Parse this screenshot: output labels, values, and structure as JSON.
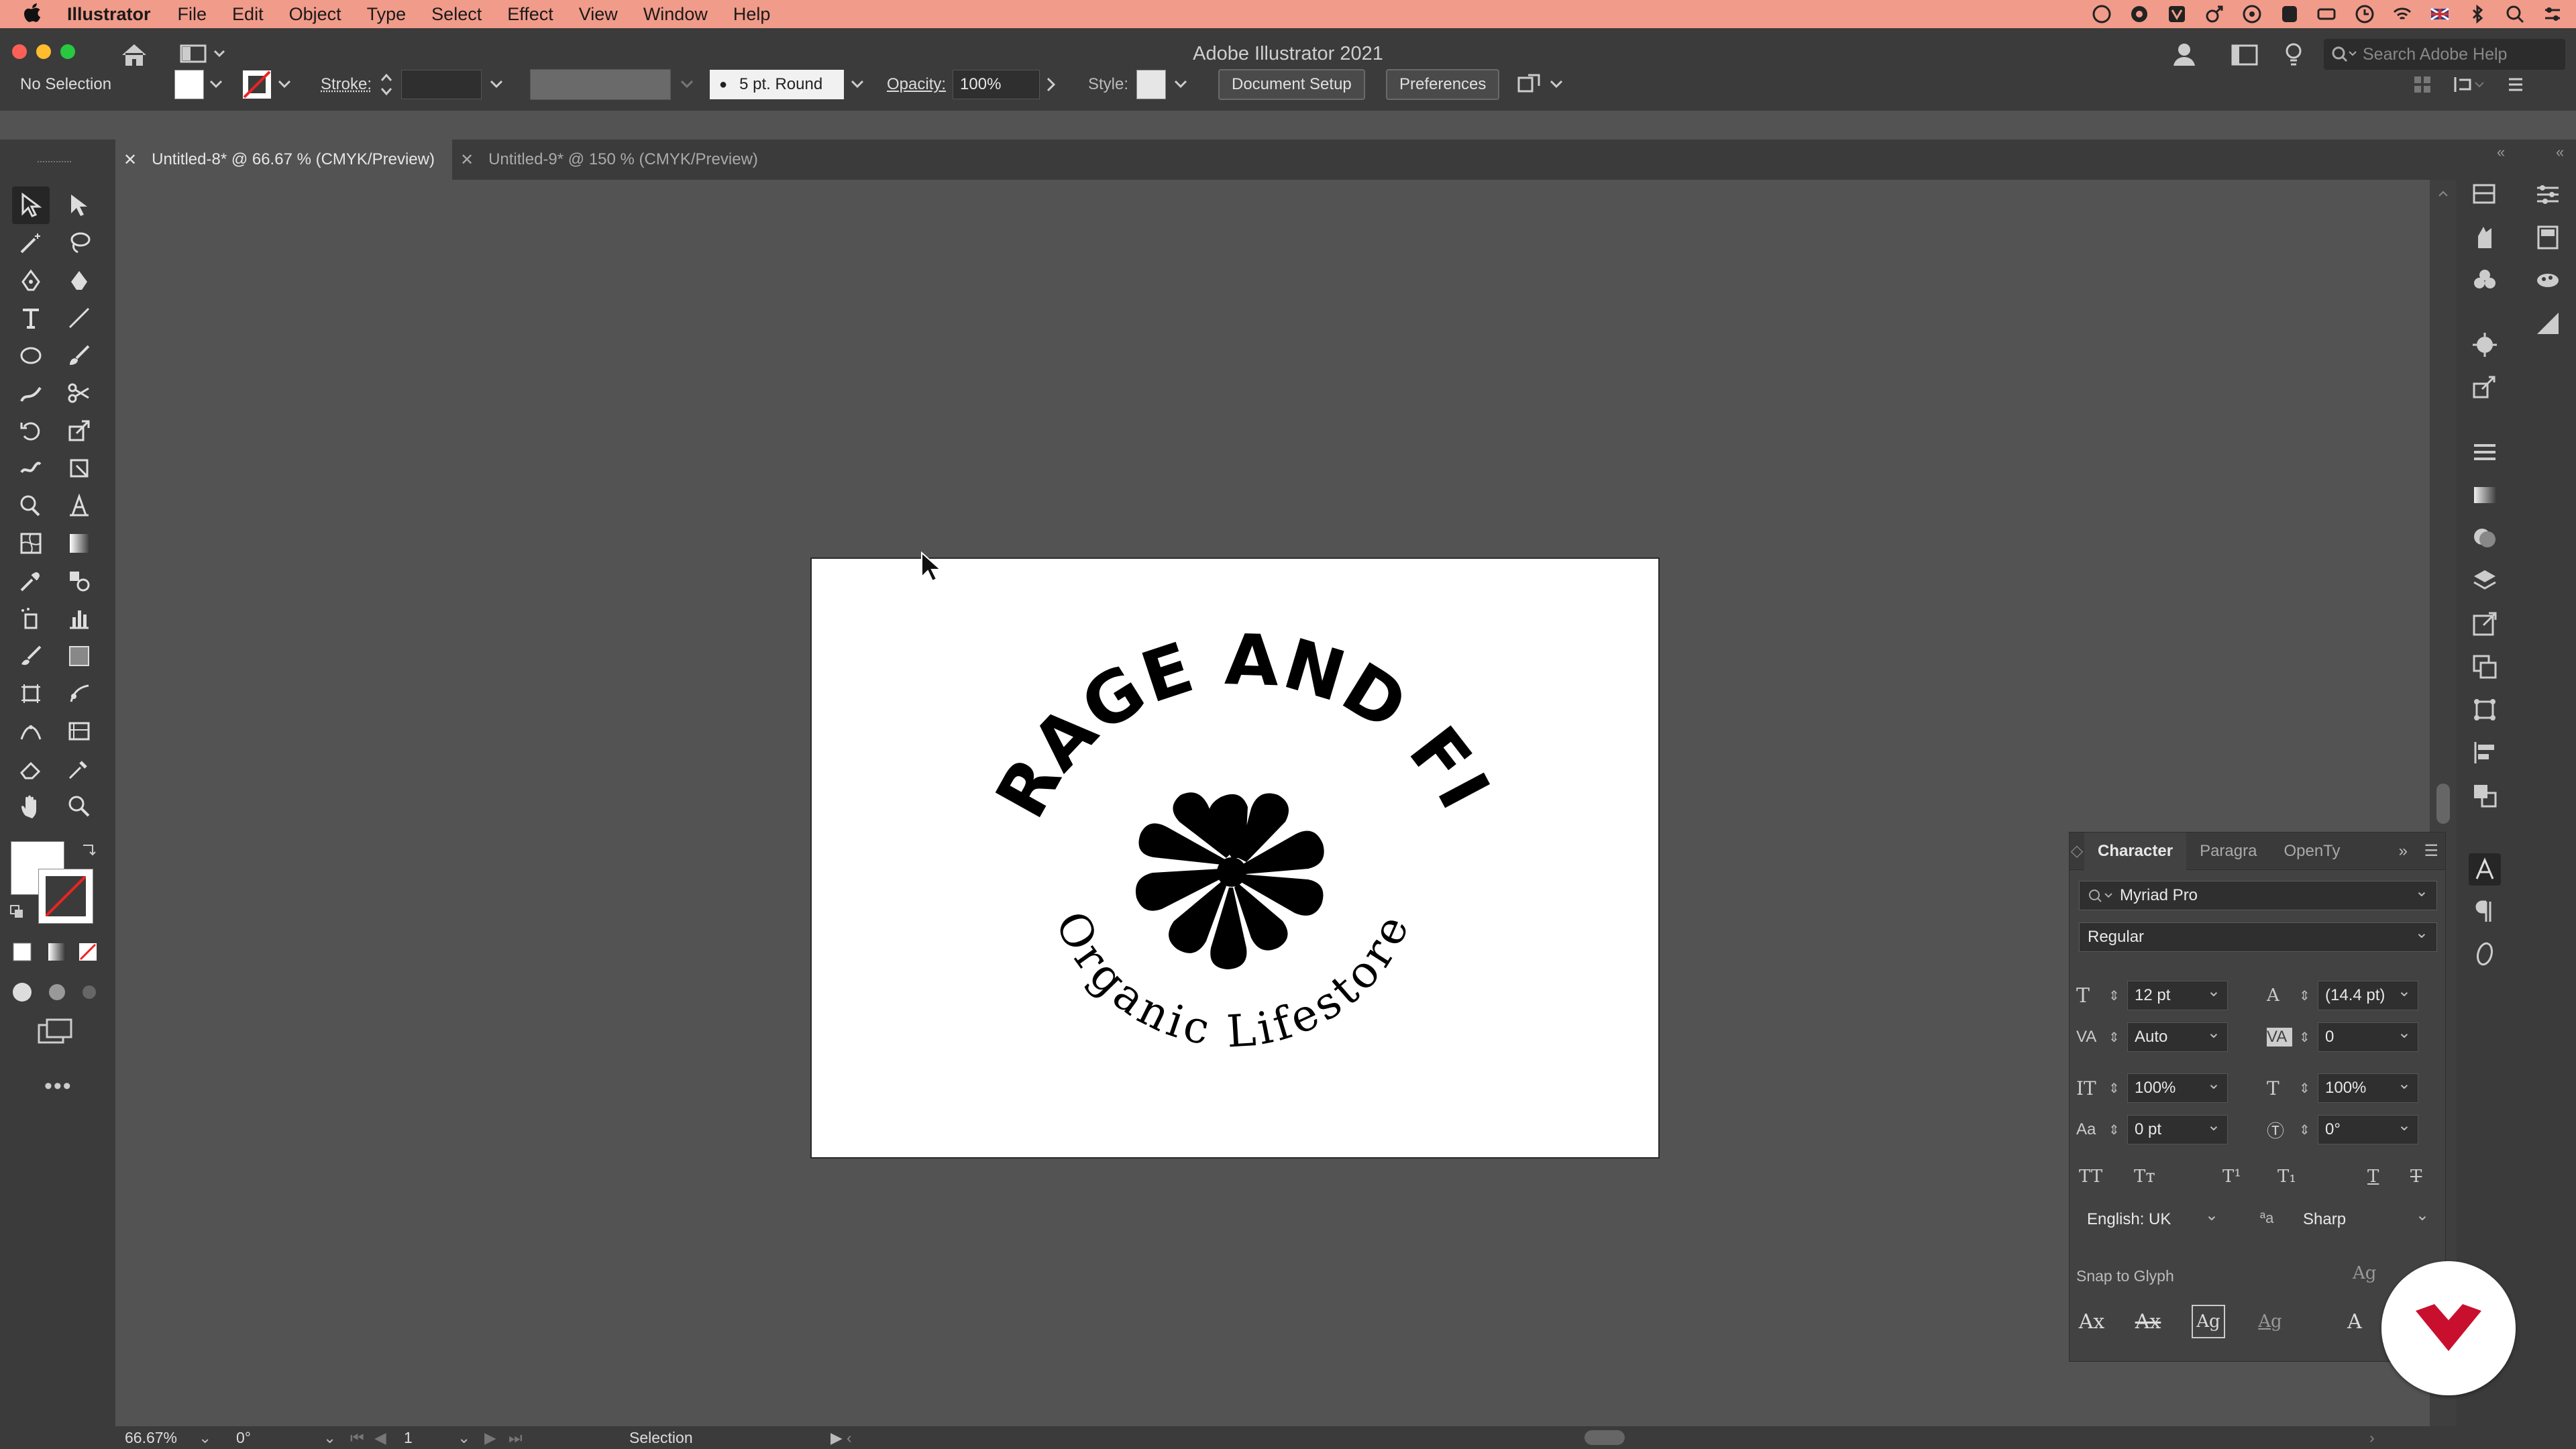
{
  "menubar": {
    "app_name": "Illustrator",
    "items": [
      "File",
      "Edit",
      "Object",
      "Type",
      "Select",
      "Effect",
      "View",
      "Window",
      "Help"
    ],
    "color": "#f19b8a"
  },
  "window": {
    "title": "Adobe Illustrator 2021",
    "search_placeholder": "Search Adobe Help"
  },
  "control_bar": {
    "selection": "No Selection",
    "stroke_label": "Stroke:",
    "brush_value": "5 pt. Round",
    "opacity_label": "Opacity:",
    "opacity_value": "100%",
    "style_label": "Style:",
    "document_setup": "Document Setup",
    "preferences": "Preferences"
  },
  "tabs": [
    {
      "label": "Untitled-8* @ 66.67 % (CMYK/Preview)",
      "active": true
    },
    {
      "label": "Untitled-9* @ 150 % (CMYK/Preview)",
      "active": false
    }
  ],
  "artwork": {
    "arc_title": "FORAGE AND FIND",
    "arc_subtitle": "Organic Lifestore"
  },
  "character_panel": {
    "tabs": [
      "Character",
      "Paragra",
      "OpenTy"
    ],
    "font_family": "Myriad Pro",
    "font_style": "Regular",
    "font_size": "12 pt",
    "leading": "(14.4 pt)",
    "kerning": "Auto",
    "tracking": "0",
    "vertical_scale": "100%",
    "horizontal_scale": "100%",
    "baseline_shift": "0 pt",
    "rotation": "0°",
    "language": "English: UK",
    "anti_alias": "Sharp",
    "snap_to_glyph": "Snap to Glyph"
  },
  "status_bar": {
    "zoom": "66.67%",
    "rotation": "0°",
    "artboard": "1",
    "tool": "Selection"
  }
}
